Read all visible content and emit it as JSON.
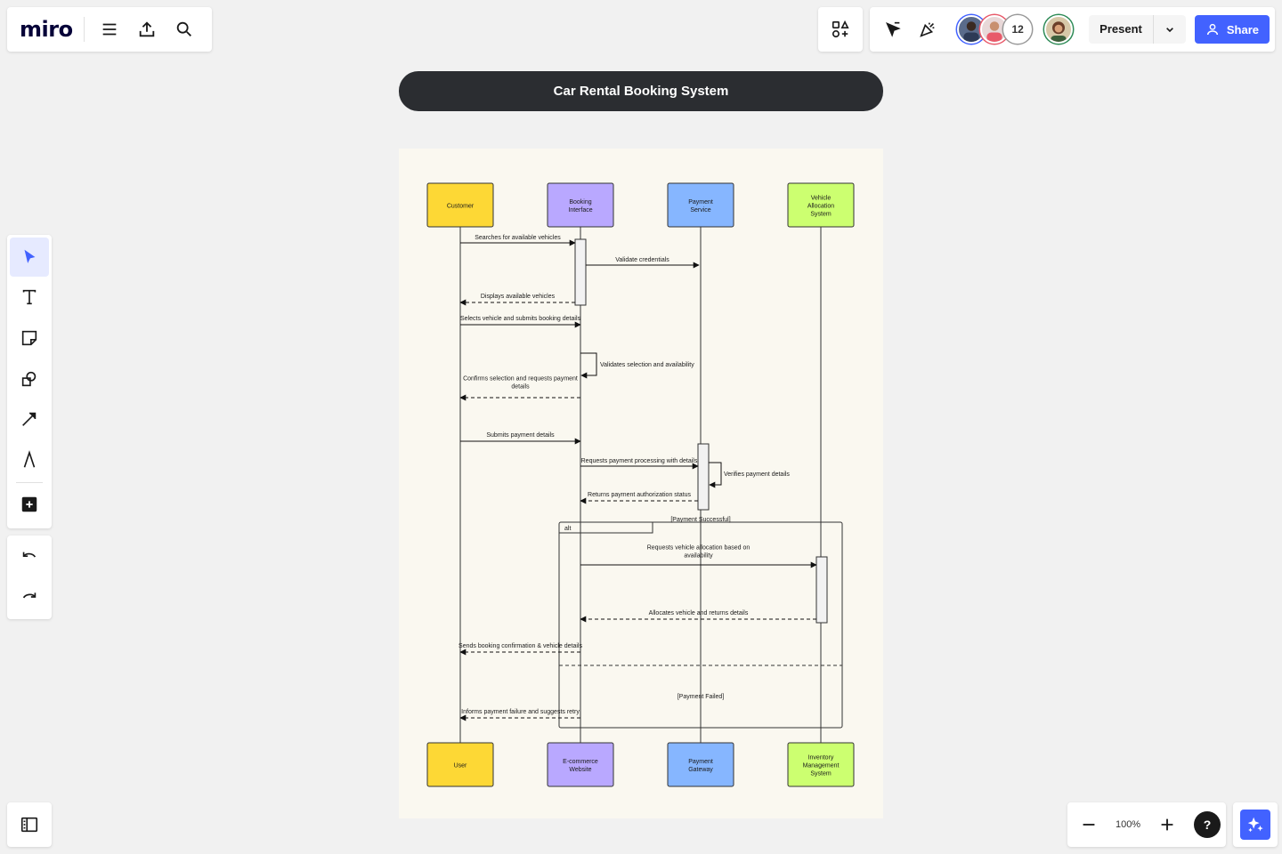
{
  "app": {
    "logo": "miro",
    "present_label": "Present",
    "share_label": "Share",
    "collaborator_count": "12",
    "zoom": "100%",
    "help": "?"
  },
  "icons": {
    "menu": "hamburger-menu-icon",
    "export": "upload-icon",
    "search": "search-icon",
    "apps": "apps-icon",
    "reactions_cursor": "cursor-icon",
    "celebrate": "party-popper-icon",
    "select": "select-arrow-icon",
    "text": "text-icon",
    "sticky": "sticky-note-icon",
    "shapes": "shapes-icon",
    "line": "arrow-line-icon",
    "pen": "pen-icon",
    "add": "add-icon",
    "undo": "undo-icon",
    "redo": "redo-icon",
    "frames": "frames-panel-icon",
    "ai": "ai-sparkle-icon"
  },
  "colors": {
    "accent": "#4262ff",
    "title_bg": "#2b2d31",
    "frame_bg": "#faf8f0",
    "customer": "#fdd835",
    "booking": "#b9a8ff",
    "payment": "#86b6ff",
    "vehicle": "#ccff70"
  },
  "board": {
    "title": "Car Rental Booking System"
  },
  "diagram": {
    "lifelines_top": [
      "Customer",
      "Booking\nInterface",
      "Payment\nService",
      "Vehicle\nAllocation\nSystem"
    ],
    "lifelines_bottom": [
      "User",
      "E-commerce\nWebsite",
      "Payment\nGateway",
      "Inventory\nManagement\nSystem"
    ],
    "messages": [
      "Searches for available vehicles",
      "Validate credentials",
      "Displays available vehicles",
      "Selects vehicle and submits booking details",
      "Validates selection and availability",
      "Confirms selection and requests payment details",
      "Submits payment details",
      "Requests payment processing with details",
      "Verifies payment details",
      "Returns payment authorization status",
      "Requests vehicle allocation based on availability",
      "Allocates vehicle and returns details",
      "Sends booking confirmation & vehicle details",
      "Informs payment failure and suggests retry"
    ],
    "fragment": {
      "operator": "alt",
      "guard_success": "[Payment Successful]",
      "guard_failed": "[Payment Failed]"
    }
  }
}
